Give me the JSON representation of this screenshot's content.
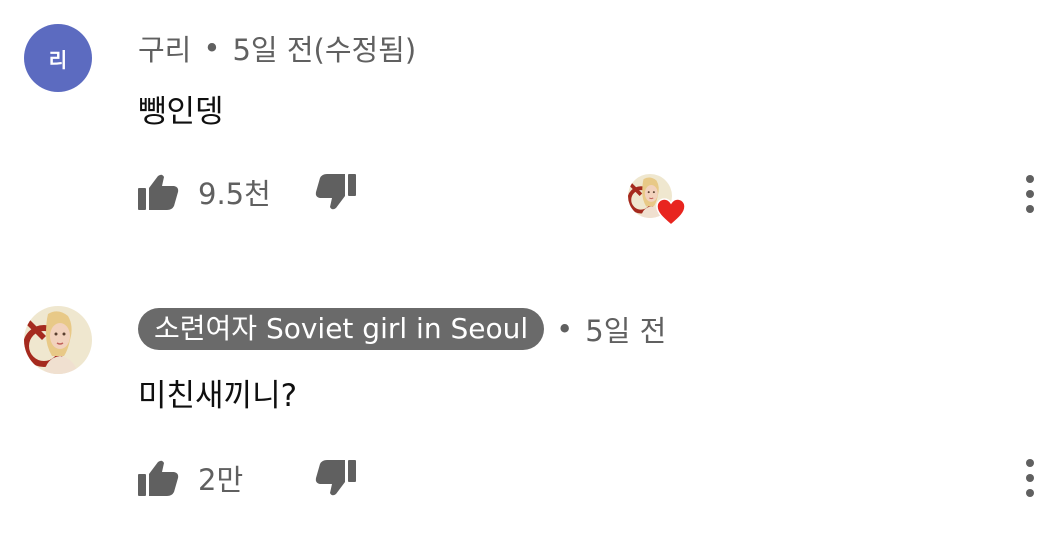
{
  "comments": [
    {
      "avatar_letter": "리",
      "avatar_color": "#5c6bc0",
      "author": "구리",
      "separator": "•",
      "time": "5일 전(수정됨)",
      "text": "뺑인뎅",
      "likes": "9.5천",
      "creator_heart": true,
      "icons": [
        "thumbs-up-icon",
        "thumbs-down-icon",
        "heart-icon",
        "more-vert-icon"
      ]
    },
    {
      "author": "소련여자 Soviet girl in Seoul",
      "author_is_channel_owner": true,
      "separator": "•",
      "time": "5일 전",
      "text": "미친새끼니?",
      "likes": "2만",
      "creator_heart": false,
      "icons": [
        "thumbs-up-icon",
        "thumbs-down-icon",
        "more-vert-icon"
      ]
    }
  ],
  "colors": {
    "meta_text": "#606060",
    "owner_pill": "#6a6a6a",
    "heart": "#e8251f",
    "icon": "#606060"
  }
}
